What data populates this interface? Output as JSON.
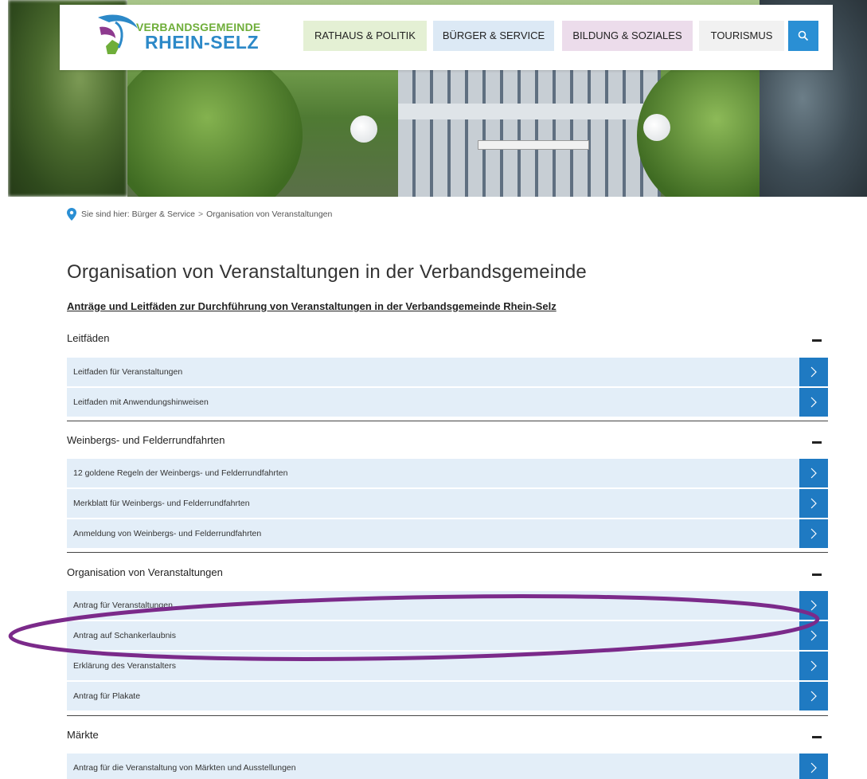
{
  "header": {
    "logo_top": "VERBANDSGEMEINDE",
    "logo_bottom": "RHEIN-SELZ",
    "nav": [
      {
        "label": "RATHAUS & POLITIK"
      },
      {
        "label": "BÜRGER & SERVICE"
      },
      {
        "label": "BILDUNG & SOZIALES"
      },
      {
        "label": "TOURISMUS"
      }
    ],
    "search_icon": "search-icon"
  },
  "breadcrumb": {
    "prefix": "Sie sind hier:",
    "items": [
      "Bürger & Service",
      "Organisation von Veranstaltungen"
    ],
    "separator": ">"
  },
  "page": {
    "title": "Organisation von Veranstaltungen in der Verbandsgemeinde",
    "subtitle": "Anträge und Leitfäden zur Durchführung von Veranstaltungen in der Verbandsgemeinde Rhein-Selz"
  },
  "sections": [
    {
      "title": "Leitfäden",
      "items": [
        "Leitfaden für Veranstaltungen",
        "Leitfaden mit Anwendungshinweisen"
      ]
    },
    {
      "title": "Weinbergs- und Felderrundfahrten",
      "items": [
        "12 goldene Regeln der Weinbergs- und Felderrundfahrten",
        "Merkblatt für Weinbergs- und Felderrundfahrten",
        "Anmeldung von Weinbergs- und Felderrundfahrten"
      ]
    },
    {
      "title": "Organisation von Veranstaltungen",
      "items": [
        "Antrag für Veranstaltungen",
        "Antrag auf Schankerlaubnis",
        "Erklärung des Veranstalters",
        "Antrag für Plakate"
      ]
    },
    {
      "title": "Märkte",
      "items": [
        "Antrag für die Veranstaltung von Märkten und Ausstellungen"
      ]
    }
  ],
  "colors": {
    "accent_blue": "#1f7ac2",
    "row_bg": "#e3eef8",
    "highlight": "#7b2a8a"
  }
}
